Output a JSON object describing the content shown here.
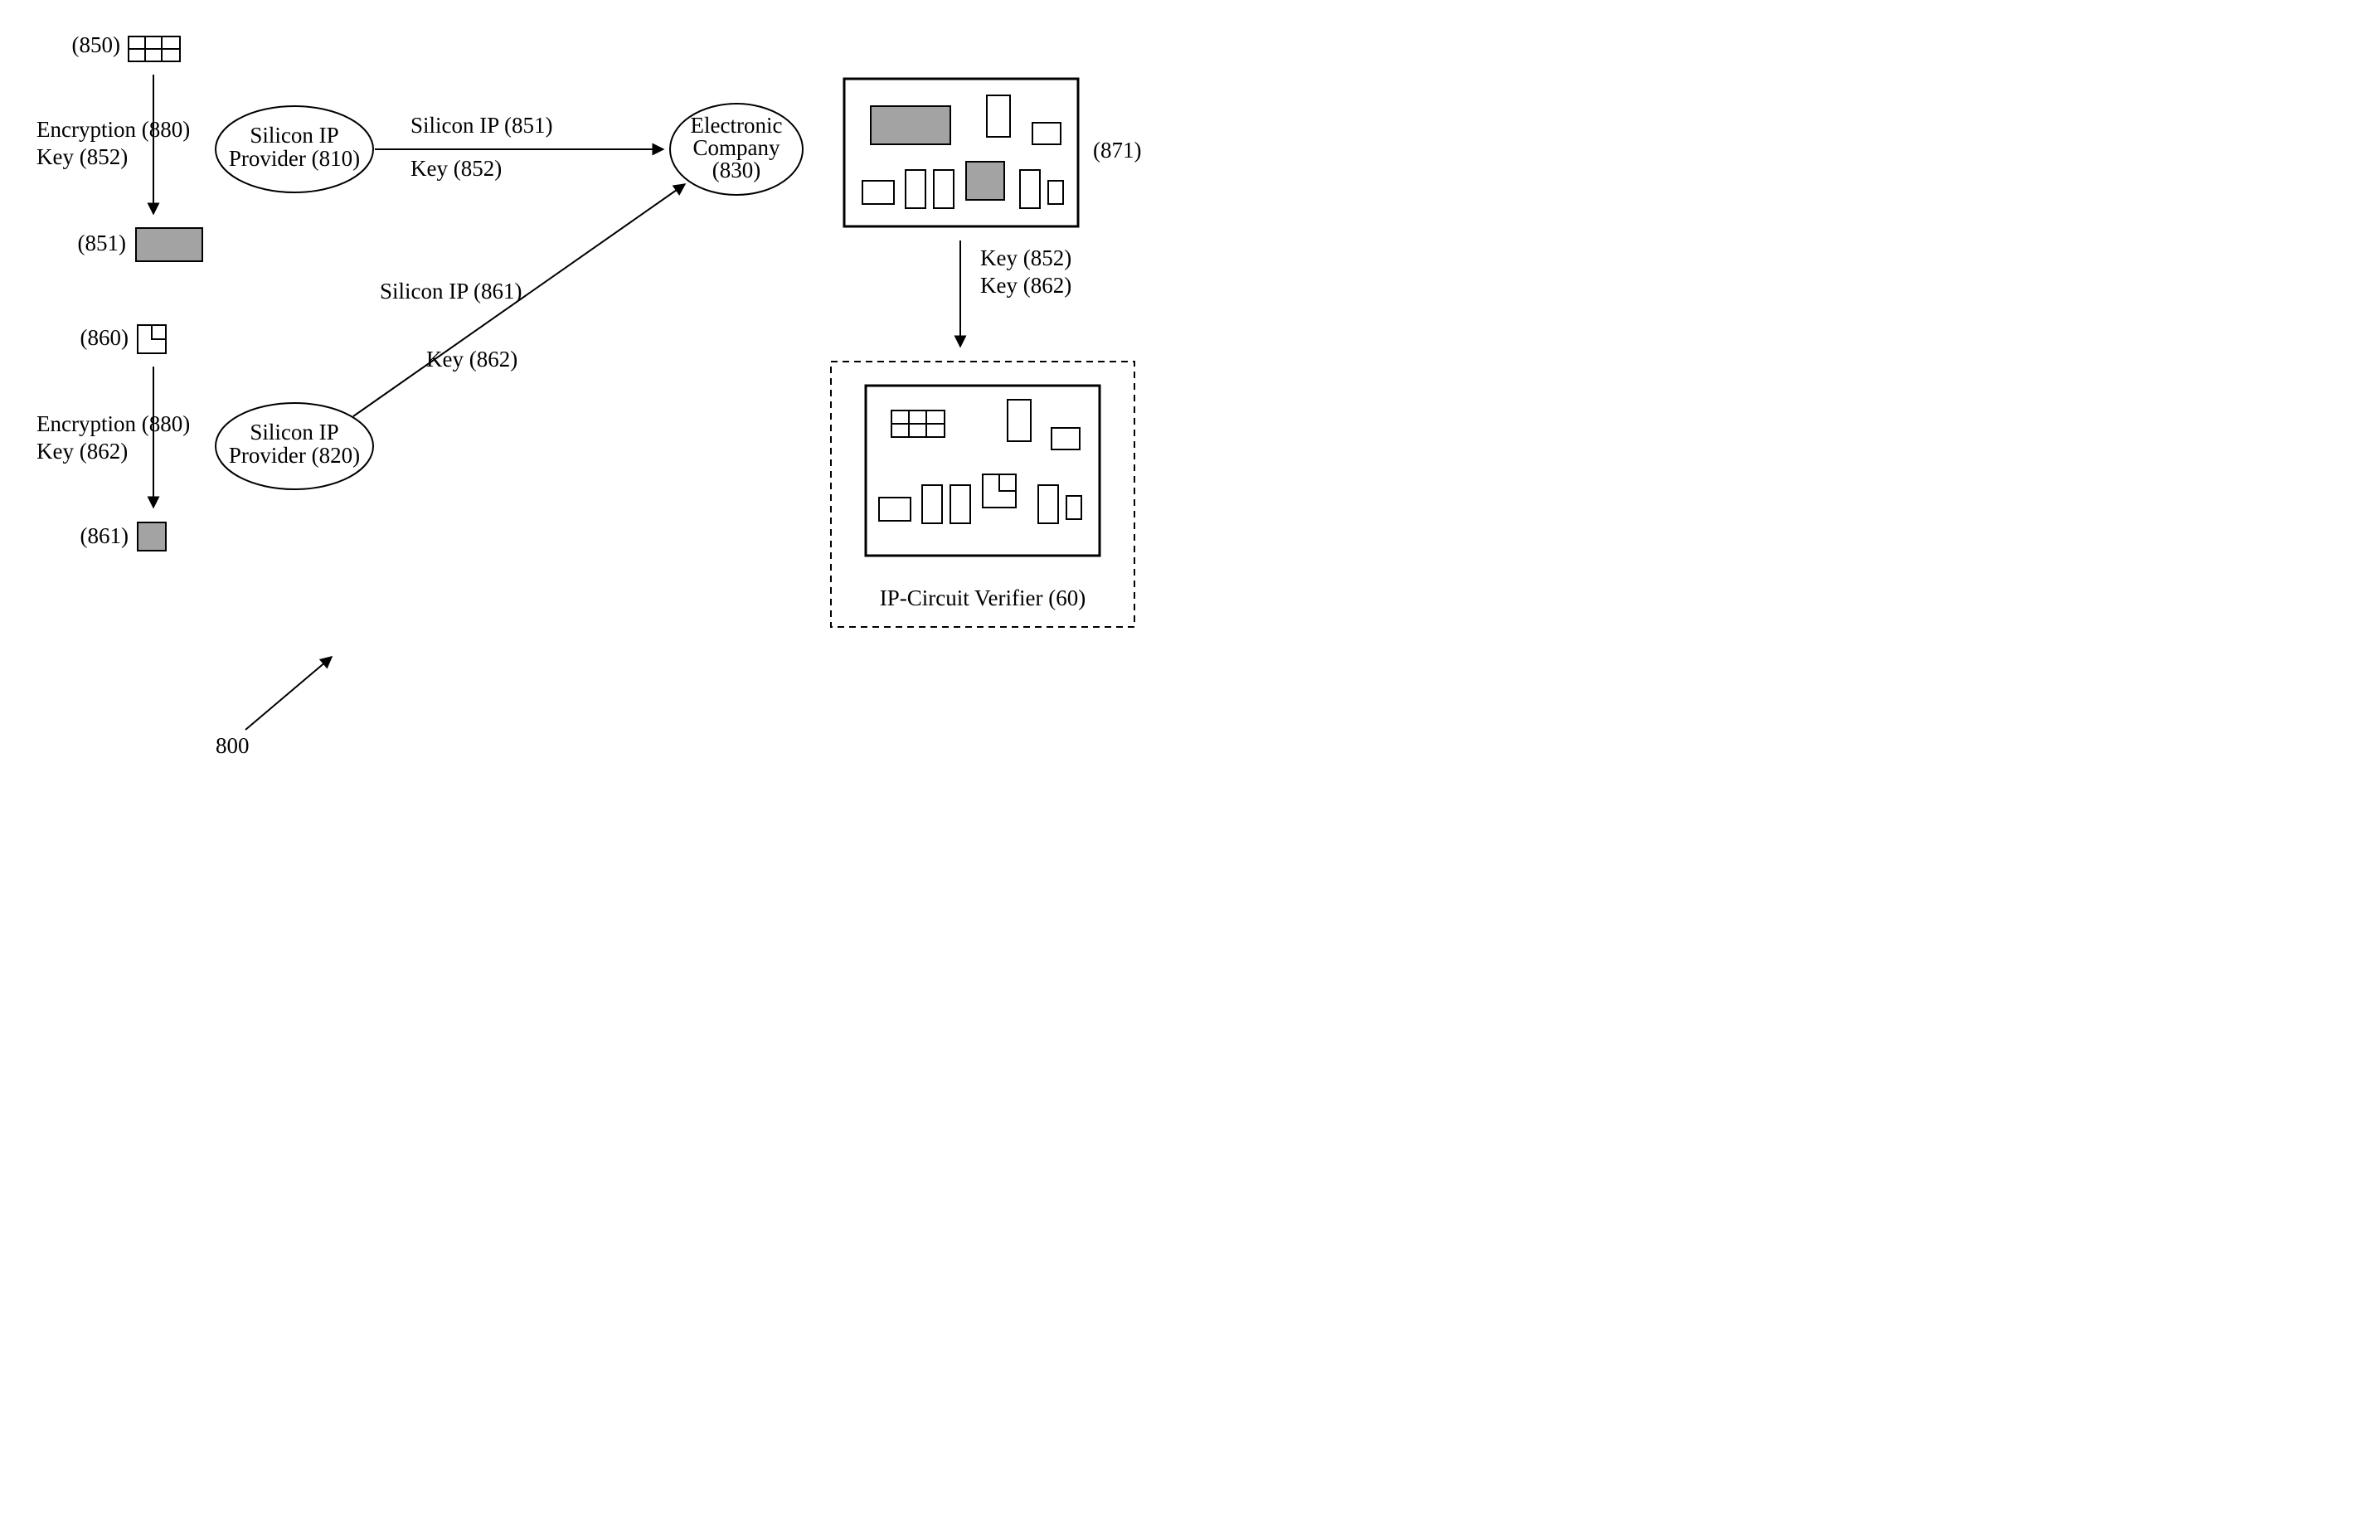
{
  "labels": {
    "l850": "(850)",
    "enc1a": "Encryption (880)",
    "enc1b": "Key (852)",
    "l851": "(851)",
    "l860": "(860)",
    "enc2a": "Encryption (880)",
    "enc2b": "Key (862)",
    "l861": "(861)",
    "prov1a": "Silicon IP",
    "prov1b": "Provider (810)",
    "prov2a": "Silicon IP",
    "prov2b": "Provider (820)",
    "edge1a": "Silicon IP (851)",
    "edge1b": "Key (852)",
    "edge2a": "Silicon IP (861)",
    "edge2b": "Key (862)",
    "compA": "Electronic",
    "compB": "Company",
    "compC": "(830)",
    "l871": "(871)",
    "key852": "Key (852)",
    "key862": "Key (862)",
    "verifier": "IP-Circuit Verifier (60)",
    "l800": "800"
  }
}
